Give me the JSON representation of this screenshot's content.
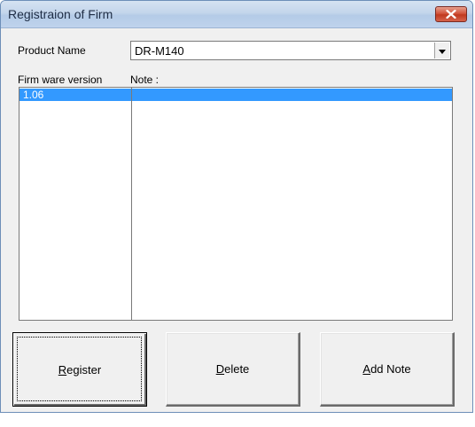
{
  "window": {
    "title": "Registraion of Firm",
    "close_icon": "close-icon"
  },
  "form": {
    "product_name_label": "Product Name",
    "product_name_value": "DR-M140",
    "firmware_version_header": "Firm ware version",
    "note_header": "Note :"
  },
  "list": {
    "rows": [
      {
        "version": "1.06",
        "note": "",
        "selected": true
      }
    ]
  },
  "buttons": {
    "register": {
      "mnemonic": "R",
      "rest": "egister"
    },
    "delete": {
      "mnemonic": "D",
      "rest": "elete"
    },
    "add_note": {
      "mnemonic": "A",
      "rest": "dd Note"
    }
  },
  "colors": {
    "selection": "#3399ff",
    "titlebar": "#c3d5eb",
    "close_button": "#c0391f"
  }
}
